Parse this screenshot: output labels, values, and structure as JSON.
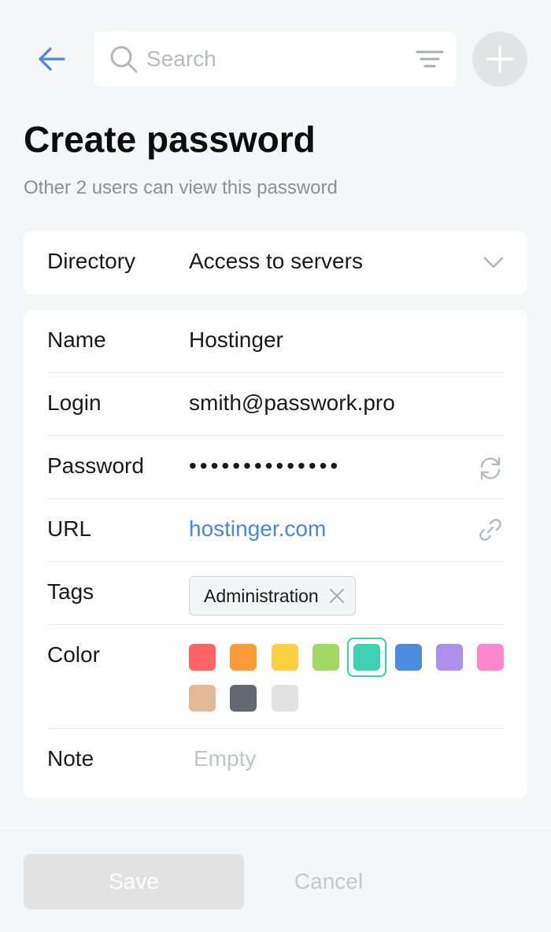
{
  "search": {
    "placeholder": "Search"
  },
  "page": {
    "title": "Create password",
    "subtitle": "Other 2 users can view this password"
  },
  "directory": {
    "label": "Directory",
    "value": "Access to servers"
  },
  "form": {
    "name": {
      "label": "Name",
      "value": "Hostinger"
    },
    "login": {
      "label": "Login",
      "value": "smith@passwork.pro"
    },
    "password": {
      "label": "Password",
      "value": "••••••••••••••"
    },
    "url": {
      "label": "URL",
      "value": "hostinger.com"
    },
    "tags": {
      "label": "Tags",
      "items": [
        "Administration"
      ]
    },
    "color": {
      "label": "Color",
      "options": [
        "#ff6464",
        "#ff9b37",
        "#ffd040",
        "#a0d964",
        "#3dd2b1",
        "#4a8ddf",
        "#ae8fec",
        "#ff86cc",
        "#e3b896",
        "#626972",
        "#e2e2e2"
      ],
      "selected_index": 4
    },
    "note": {
      "label": "Note",
      "placeholder": "Empty"
    }
  },
  "actions": {
    "save": "Save",
    "cancel": "Cancel"
  },
  "icons": {
    "back": "arrow-left-icon",
    "search": "search-icon",
    "filter": "filter-icon",
    "add": "plus-icon",
    "dropdown": "chevron-down-icon",
    "regenerate": "refresh-icon",
    "open_link": "link-icon",
    "remove_tag": "close-icon"
  },
  "colors": {
    "accent": "#4a86dd",
    "selected_ring": "#39cfb0"
  }
}
